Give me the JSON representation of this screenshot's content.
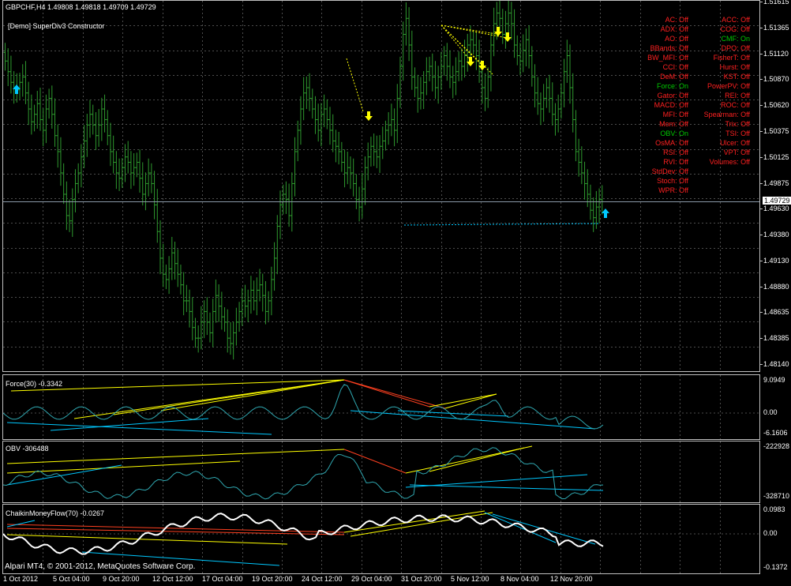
{
  "header": {
    "symbol_line": "GBPCHF,H4  1.49808 1.49818 1.49709 1.49729",
    "indicator_name": "[Demo] SuperDiv3 Constructor"
  },
  "colors": {
    "background": "#000000",
    "grid": "#4d4d4d",
    "candle": "#2e9a2e",
    "osc_line": "#2fa7b0",
    "divergence_yellow": "#ffff00",
    "divergence_red": "#ff4020",
    "divergence_cyan": "#00c8ff",
    "status_on": "#00c800",
    "status_off": "#ff2020",
    "cmf_line": "#ffffff",
    "current_price_line": "#8a9aa8"
  },
  "status_left": [
    "AC: Off",
    "ADX: Off",
    "AO: Off",
    "BBands: Off",
    "BW_MFI: Off",
    "CCI: Off",
    "DeM: Off",
    "Force: On",
    "Gator: Off",
    "MACD: Off",
    "MFI: Off",
    "Mom: Off",
    "OBV: On",
    "OsMA: Off",
    "RSI: Off",
    "RVI: Off",
    "StdDev: Off",
    "Stoch: Off",
    "WPR: Off"
  ],
  "status_right": [
    "ACC: Off",
    "COG: Off",
    "CMF: On",
    "DPO: Off",
    "FisherT: Off",
    "Hurst: Off",
    "KST: Off",
    "PowerPV: Off",
    "REI: Off",
    "ROC: Off",
    "Spearman: Off",
    "Trix: Off",
    "TSI: Off",
    "Ulcer: Off",
    "VPT: Off",
    "Volumes: Off"
  ],
  "subwindows": {
    "force_title": "Force(30) -0.3342",
    "obv_title": "OBV -306488",
    "cmf_title": "ChaikinMoneyFlow(70) -0.0267"
  },
  "copyright": "Alpari MT4, © 2001-2012, MetaQuotes Software Corp.",
  "chart_data": [
    {
      "type": "candlestick",
      "title": "GBPCHF,H4",
      "y_ticks": [
        "1.51615",
        "1.51365",
        "1.51120",
        "1.50870",
        "1.50620",
        "1.50375",
        "1.50125",
        "1.49875",
        "1.49630",
        "1.49380",
        "1.49130",
        "1.48880",
        "1.48635",
        "1.48385",
        "1.48140"
      ],
      "ylim": [
        1.4814,
        1.51615
      ],
      "current_price": "1.49729",
      "x_labels": [
        "1 Oct 2012",
        "5 Oct 04:00",
        "9 Oct 20:00",
        "12 Oct 12:00",
        "17 Oct 04:00",
        "19 Oct 20:00",
        "24 Oct 12:00",
        "29 Oct 04:00",
        "31 Oct 20:00",
        "5 Nov 12:00",
        "8 Nov 04:00",
        "12 Nov 20:00"
      ],
      "close": [
        1.5105,
        1.5095,
        1.5085,
        1.508,
        1.5078,
        1.5085,
        1.509,
        1.5075,
        1.506,
        1.5048,
        1.5055,
        1.5065,
        1.505,
        1.504,
        1.506,
        1.507,
        1.5055,
        1.5035,
        1.502,
        1.5,
        1.498,
        1.496,
        1.4955,
        1.4975,
        1.499,
        1.5,
        1.5015,
        1.503,
        1.5045,
        1.5055,
        1.5045,
        1.5035,
        1.5045,
        1.506,
        1.505,
        1.5035,
        1.502,
        1.501,
        1.5,
        1.4995,
        1.5005,
        1.5015,
        1.501,
        1.5,
        1.5005,
        1.501,
        1.4995,
        1.498,
        1.499,
        1.5,
        1.499,
        1.497,
        1.4945,
        1.492,
        1.4905,
        1.49,
        1.491,
        1.4925,
        1.4915,
        1.4905,
        1.4895,
        1.488,
        1.488,
        1.487,
        1.4855,
        1.4845,
        1.4845,
        1.486,
        1.487,
        1.486,
        1.485,
        1.487,
        1.4885,
        1.4875,
        1.4865,
        1.486,
        1.4845,
        1.484,
        1.485,
        1.486,
        1.487,
        1.488,
        1.4875,
        1.488,
        1.489,
        1.488,
        1.489,
        1.4895,
        1.4885,
        1.487,
        1.488,
        1.49,
        1.492,
        1.495,
        1.497,
        1.498,
        1.4975,
        1.496,
        1.499,
        1.502,
        1.504,
        1.506,
        1.5075,
        1.508,
        1.507,
        1.506,
        1.505,
        1.504,
        1.5055,
        1.506,
        1.505,
        1.504,
        1.503,
        1.5025,
        1.502,
        1.501,
        1.5,
        1.5005,
        1.5,
        1.499,
        1.4975,
        1.4968,
        1.4985,
        1.5005,
        1.5015,
        1.5025,
        1.502,
        1.5015,
        1.5025,
        1.503,
        1.504,
        1.5045,
        1.505,
        1.504,
        1.507,
        1.51,
        1.513,
        1.5145,
        1.512,
        1.509,
        1.508,
        1.507,
        1.5075,
        1.5085,
        1.5095,
        1.51,
        1.509,
        1.508,
        1.509,
        1.51,
        1.511,
        1.51,
        1.509,
        1.5085,
        1.5095,
        1.5105,
        1.51,
        1.511,
        1.512,
        1.5125,
        1.512,
        1.511,
        1.5095,
        1.508,
        1.507,
        1.509,
        1.512,
        1.514,
        1.515,
        1.5145,
        1.513,
        1.514,
        1.515,
        1.514,
        1.512,
        1.511,
        1.5105,
        1.5115,
        1.5125,
        1.511,
        1.509,
        1.5075,
        1.5065,
        1.506,
        1.507,
        1.508,
        1.507,
        1.5055,
        1.505,
        1.506,
        1.5075,
        1.5095,
        1.511,
        1.508,
        1.505,
        1.502,
        1.501,
        1.5,
        1.499,
        1.498,
        1.4965,
        1.4958,
        1.4968,
        1.4975,
        1.4973
      ],
      "markers_down_arrow_yellow": 6,
      "markers_up_arrow_cyan": 2
    },
    {
      "type": "line",
      "title": "Force(30) -0.3342",
      "y_ticks": [
        "9.0949",
        "0.00",
        "-6.1606"
      ],
      "ylim": [
        -6.1606,
        9.0949
      ]
    },
    {
      "type": "line",
      "title": "OBV -306488",
      "y_ticks": [
        "-222928",
        "-328710"
      ],
      "ylim": [
        -328710,
        -222928
      ]
    },
    {
      "type": "line",
      "title": "ChaikinMoneyFlow(70) -0.0267",
      "y_ticks": [
        "0.0983",
        "0.00",
        "-0.1372"
      ],
      "ylim": [
        -0.1372,
        0.0983
      ]
    }
  ]
}
